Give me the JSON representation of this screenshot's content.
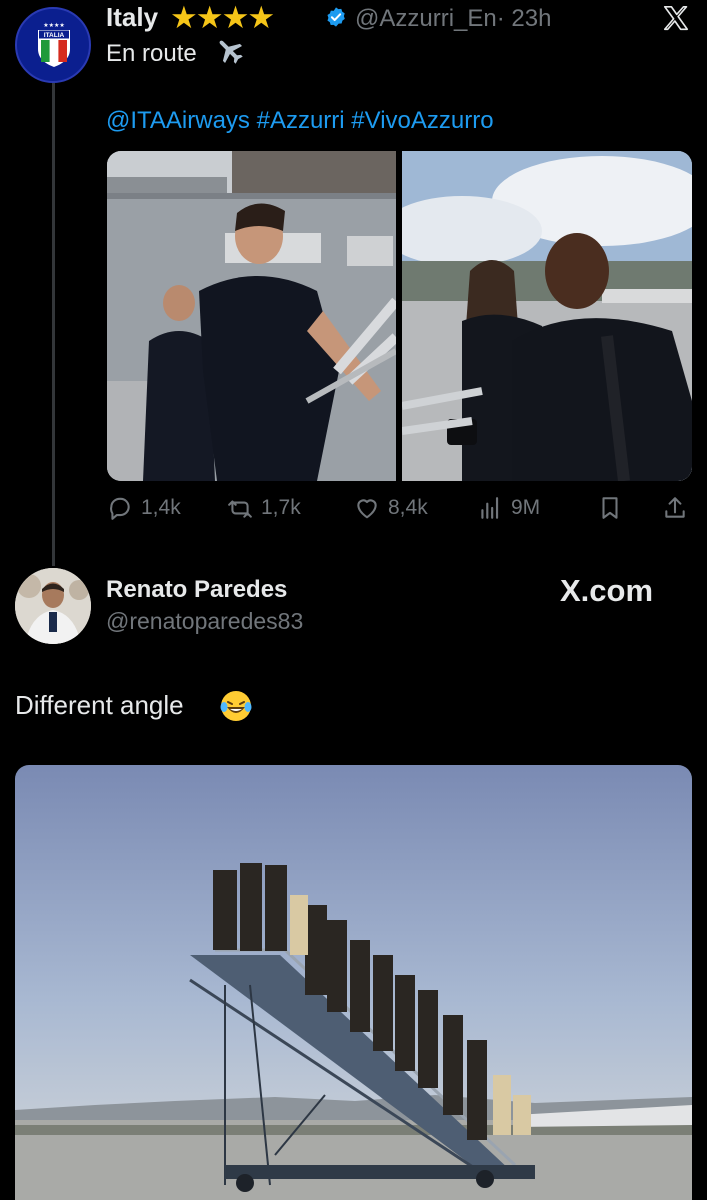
{
  "colors": {
    "background": "#000000",
    "text": "#e7e9ea",
    "secondary": "#71767b",
    "link": "#1d9bf0",
    "verified": "#1d9bf0"
  },
  "post": {
    "author_name": "Italy",
    "author_emoji": "★★★★",
    "handle": "@Azzurri_En",
    "time": "· 23h",
    "text": "En route",
    "text_emoji_icon": "airplane-icon",
    "hashtags": "@ITAAirways #Azzurri #VivoAzzurro",
    "avatar_label": "ITALIA",
    "media": [
      {
        "icon": "photo-players-left"
      },
      {
        "icon": "photo-players-right"
      }
    ],
    "stats": {
      "replies": "1,4k",
      "reposts": "1,7k",
      "likes": "8,4k",
      "views": "9M"
    }
  },
  "reply": {
    "author_name": "Renato Paredes",
    "handle": "@renatoparedes83",
    "text": "Different angle",
    "text_emoji_icon": "laughing-tears-icon",
    "watermark": "X.com",
    "media": {
      "icon": "airstair-photo"
    }
  }
}
